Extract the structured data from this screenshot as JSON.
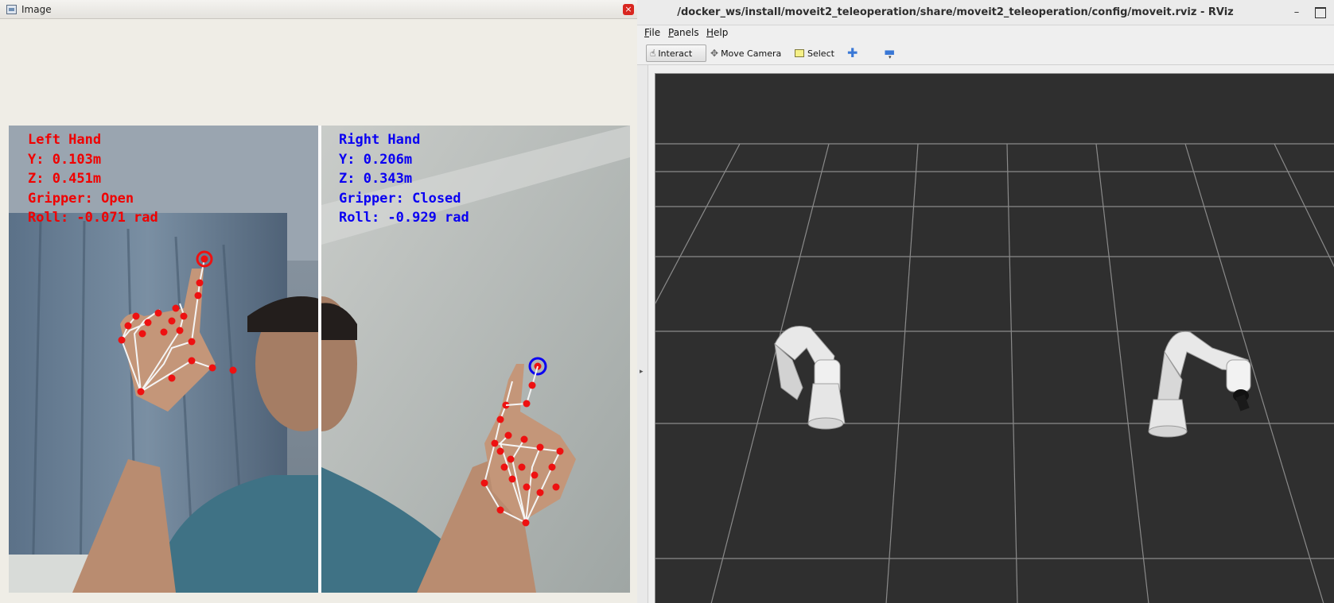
{
  "image_window": {
    "title": "Image",
    "close_label": "×",
    "left_hand": {
      "lines": [
        "Left Hand",
        "Y: 0.103m",
        "Z: 0.451m",
        "Gripper: Open",
        "Roll: -0.071 rad"
      ],
      "color": "#f00000"
    },
    "right_hand": {
      "lines": [
        "Right Hand",
        "Y: 0.206m",
        "Z: 0.343m",
        "Gripper: Closed",
        "Roll: -0.929 rad"
      ],
      "color": "#0a00f2"
    },
    "landmark_color": "#ee1111",
    "skeleton_color": "#f5f5f5"
  },
  "rviz": {
    "title": "/docker_ws/install/moveit2_teleoperation/share/moveit2_teleoperation/config/moveit.rviz - RViz",
    "minimize_label": "–",
    "menu": {
      "file": {
        "ul": "F",
        "rest": "ile"
      },
      "panels": {
        "ul": "P",
        "rest": "anels"
      },
      "help": {
        "ul": "H",
        "rest": "elp"
      }
    },
    "toolbar": {
      "interact": "Interact",
      "move_camera": "Move Camera",
      "select": "Select",
      "add_icon": "plus-icon",
      "remove_icon": "minus-icon"
    },
    "viewport_bg": "#2f2f2f",
    "grid_color": "#8a8a8a"
  }
}
